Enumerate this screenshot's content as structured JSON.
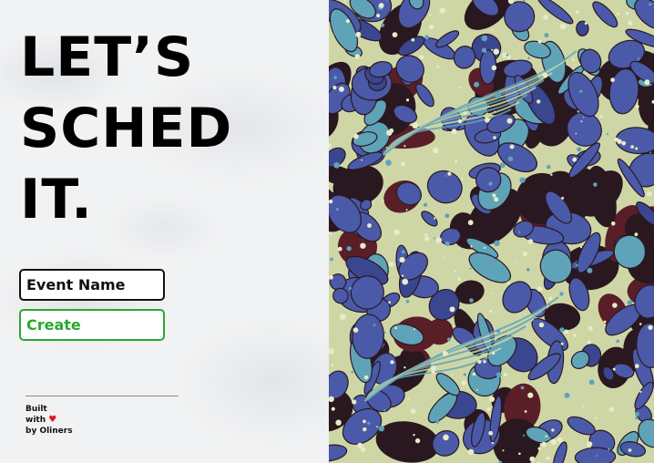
{
  "title": {
    "line1": "LET’S",
    "line2": "SCHED",
    "line3": "IT."
  },
  "event_input": {
    "placeholder": "Event Name",
    "value": ""
  },
  "create_button": {
    "label": "Create"
  },
  "footer": {
    "line1": "Built",
    "line2": "with",
    "line3": "by Oliners",
    "heart": "♥"
  },
  "colors": {
    "accent_green": "#2aa830",
    "heart_red": "#e01818",
    "marble_blue": "#4a5aa8",
    "marble_teal": "#5fa3b8",
    "marble_cream": "#cfd6a6",
    "marble_dark": "#2a1820"
  },
  "icons": {
    "heart": "heart-icon"
  }
}
